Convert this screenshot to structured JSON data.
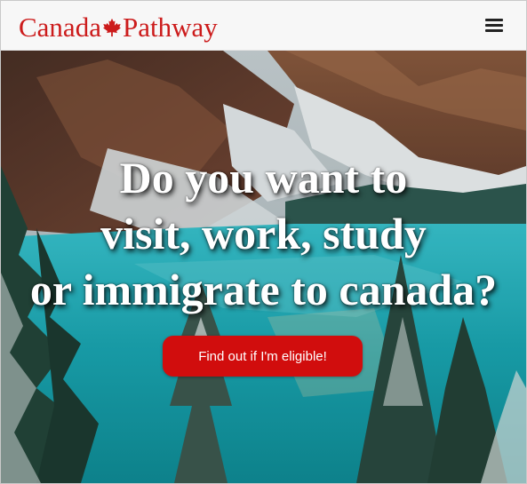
{
  "header": {
    "brand_left": "Canada",
    "brand_right": "Pathway",
    "brand_color": "#cc1b1b",
    "logo_icon": "maple-leaf-icon",
    "menu_icon": "hamburger-menu-icon"
  },
  "hero": {
    "headline_lines": [
      "Do you want to",
      "visit, work, study",
      "or immigrate to canada?"
    ],
    "cta_label": "Find out if I'm eligible!",
    "cta_color": "#d10d0d",
    "background": "lake-mountain-forest-image"
  }
}
